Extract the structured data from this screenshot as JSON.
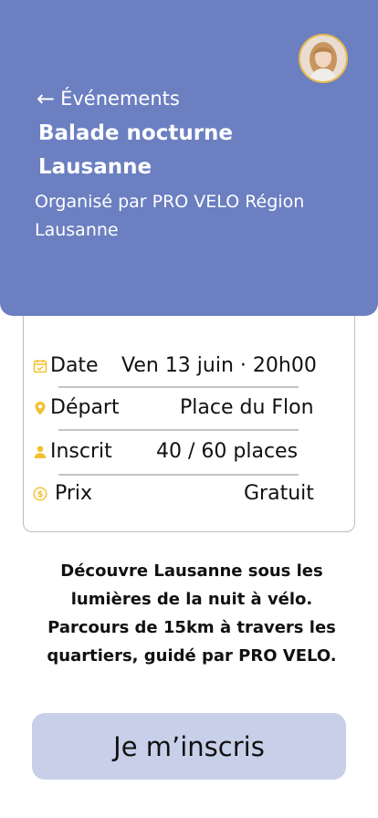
{
  "header": {
    "back_label": "Événements",
    "title": "Balade nocturne Lausanne",
    "organizer": "Organisé par PRO VELO Région Lausanne",
    "background_color": "#6b7fc1"
  },
  "details": {
    "rows": [
      {
        "icon": "calendar-icon",
        "label": "Date",
        "value": "Ven 13 juin · 20h00"
      },
      {
        "icon": "location-pin-icon",
        "label": "Départ",
        "value": "Place du Flon"
      },
      {
        "icon": "person-icon",
        "label": "Inscrit",
        "value": "40 / 60 places"
      },
      {
        "icon": "dollar-coin-icon",
        "label": "Prix",
        "value": "Gratuit"
      }
    ],
    "icon_color": "#f2c12e"
  },
  "description": "Découvre Lausanne sous les lumières de la nuit à vélo. Parcours de 15km à travers les quartiers, guidé par PRO VELO.",
  "cta": {
    "label": "Je m’inscris",
    "background_color": "#c8cfe9"
  }
}
